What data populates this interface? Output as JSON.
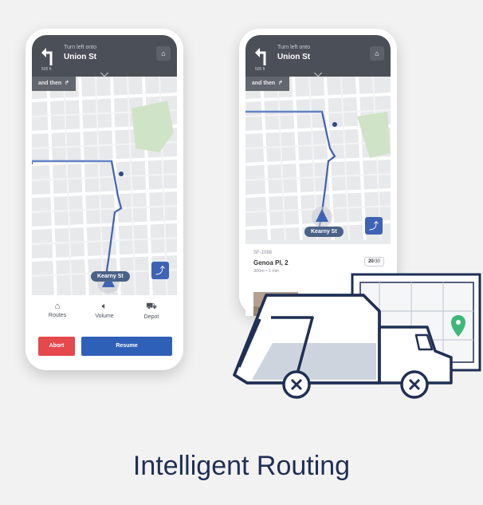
{
  "phone_left": {
    "nav": {
      "instruction": "Turn left onto",
      "street": "Union St",
      "distance": "505 ft"
    },
    "and_then": "and then",
    "street_label": "Kearny St",
    "bottom_nav": [
      {
        "label": "Routes",
        "icon": "home-icon"
      },
      {
        "label": "Volume",
        "icon": "volume-icon"
      },
      {
        "label": "Depot",
        "icon": "truck-icon"
      }
    ],
    "abort_label": "Abort",
    "resume_label": "Resume"
  },
  "phone_right": {
    "nav": {
      "instruction": "Turn left onto",
      "street": "Union St",
      "distance": "505 ft"
    },
    "and_then": "and then",
    "street_label": "Kearny St",
    "stop": {
      "id": "SF-1088",
      "name": "Genoa Pl, 2",
      "meta": "300m • 1 min",
      "count": "20",
      "total": "/30"
    }
  },
  "tagline": "Intelligent Routing",
  "colors": {
    "title": "#1f2f55",
    "route_line": "#3e62b4",
    "nav_bar": "#4b4f57",
    "abort": "#e5484d",
    "resume": "#2f60b8",
    "truck_outline": "#1f2f55",
    "pin": "#3cb878"
  }
}
